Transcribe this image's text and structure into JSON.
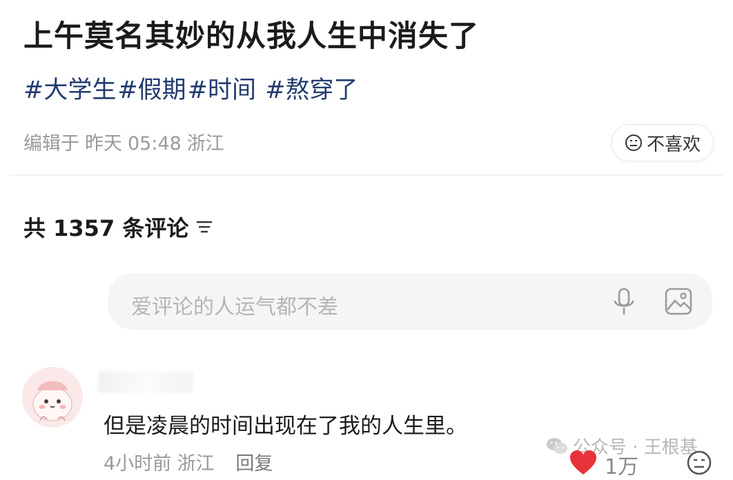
{
  "post": {
    "title": "上午莫名其妙的从我人生中消失了",
    "tags": [
      "#大学生",
      "#假期",
      "#时间",
      "#熬穿了"
    ],
    "meta": {
      "edited_label": "编辑于",
      "date": "昨天",
      "time": "05:48",
      "location": "浙江"
    },
    "dislike_label": "不喜欢"
  },
  "comments": {
    "count_label": "共 1357 条评论",
    "input_placeholder": "爱评论的人运气都不差",
    "items": [
      {
        "text": "但是凌晨的时间出现在了我的人生里。",
        "time": "4小时前",
        "location": "浙江",
        "reply_label": "回复",
        "likes": "1万"
      }
    ]
  },
  "watermark": {
    "text": "公众号 · 王根基"
  },
  "colors": {
    "tag": "#223a6e",
    "heart": "#e8323a",
    "meta": "#9a9a9a"
  }
}
